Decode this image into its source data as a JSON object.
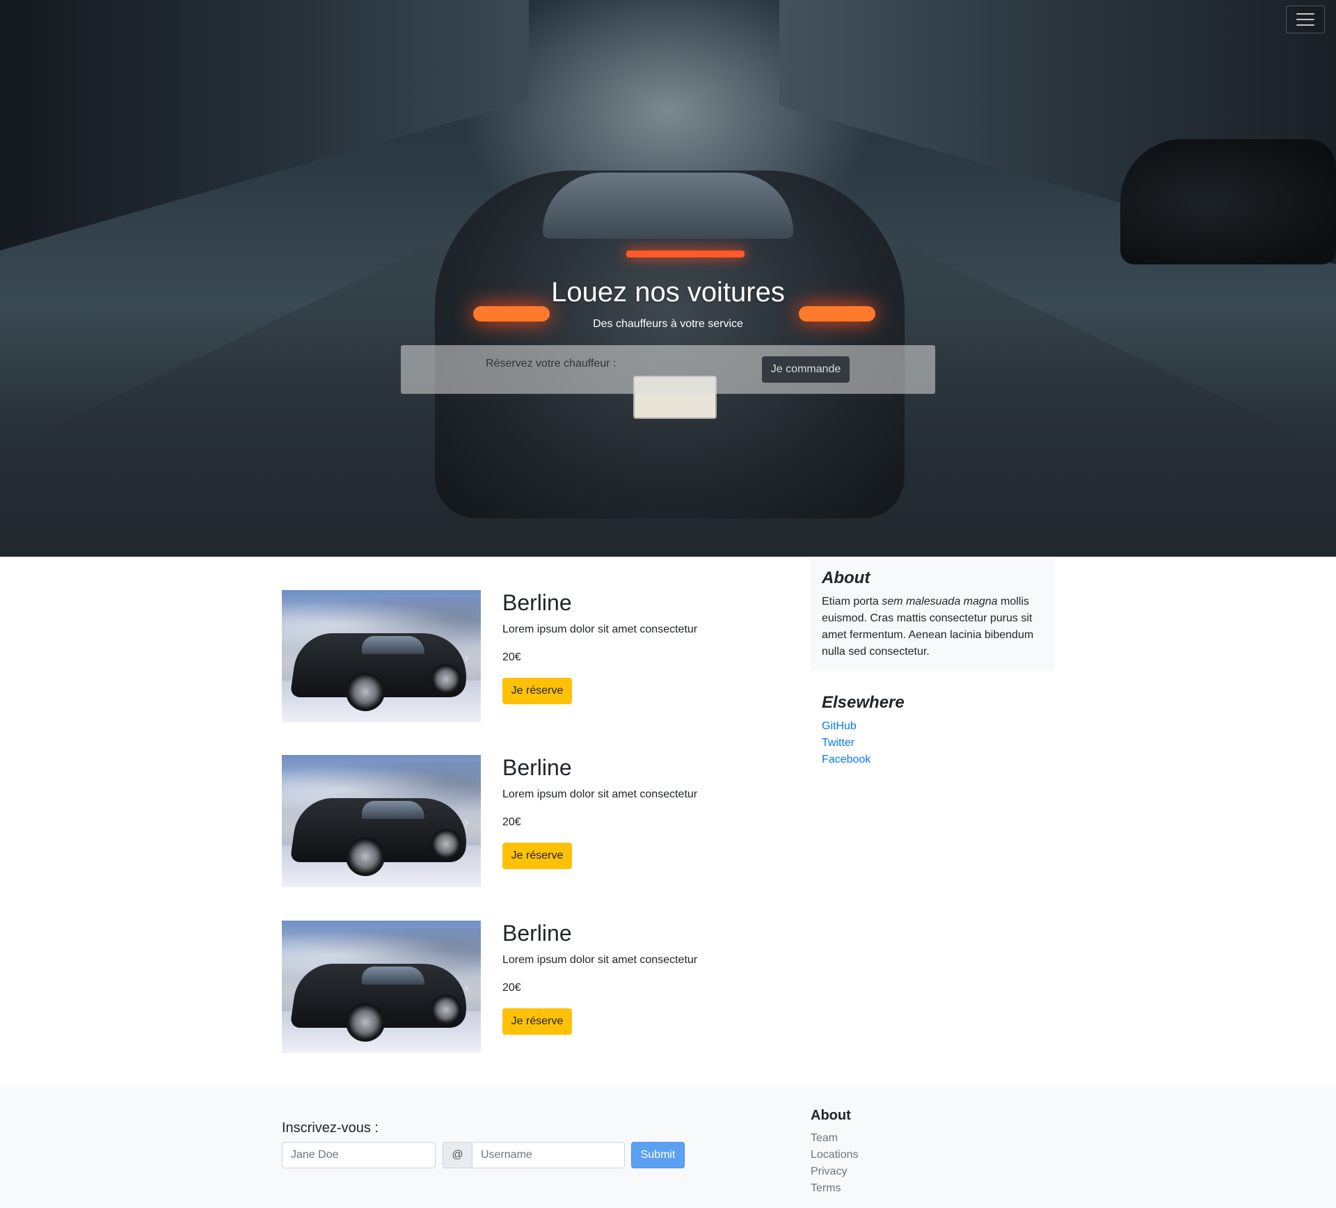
{
  "hero": {
    "title": "Louez nos voitures",
    "subtitle": "Des chauffeurs à votre service",
    "booking_label": "Réservez votre chauffeur :",
    "booking_button": "Je commande",
    "menu_icon": "hamburger-icon"
  },
  "cars": [
    {
      "title": "Berline",
      "description": "Lorem ipsum dolor sit amet consectetur",
      "price": "20€",
      "button": "Je réserve"
    },
    {
      "title": "Berline",
      "description": "Lorem ipsum dolor sit amet consectetur",
      "price": "20€",
      "button": "Je réserve"
    },
    {
      "title": "Berline",
      "description": "Lorem ipsum dolor sit amet consectetur",
      "price": "20€",
      "button": "Je réserve"
    }
  ],
  "sidebar": {
    "about_title": "About",
    "about_text_before": "Etiam porta ",
    "about_text_em": "sem malesuada magna",
    "about_text_after": " mollis euismod. Cras mattis consectetur purus sit amet fermentum. Aenean lacinia bibendum nulla sed consectetur.",
    "elsewhere_title": "Elsewhere",
    "links": [
      "GitHub",
      "Twitter",
      "Facebook"
    ]
  },
  "footer": {
    "signup_label": "Inscrivez-vous :",
    "name_placeholder": "Jane Doe",
    "at_symbol": "@",
    "username_placeholder": "Username",
    "submit_label": "Submit",
    "about_title": "About",
    "links": [
      "Team",
      "Locations",
      "Privacy",
      "Terms"
    ]
  },
  "colors": {
    "accent_yellow": "#ffc107",
    "link_blue": "#007bff",
    "dark_button": "#343a40",
    "submit_blue": "#5ba0f2",
    "light_bg": "#f8f9fa"
  }
}
